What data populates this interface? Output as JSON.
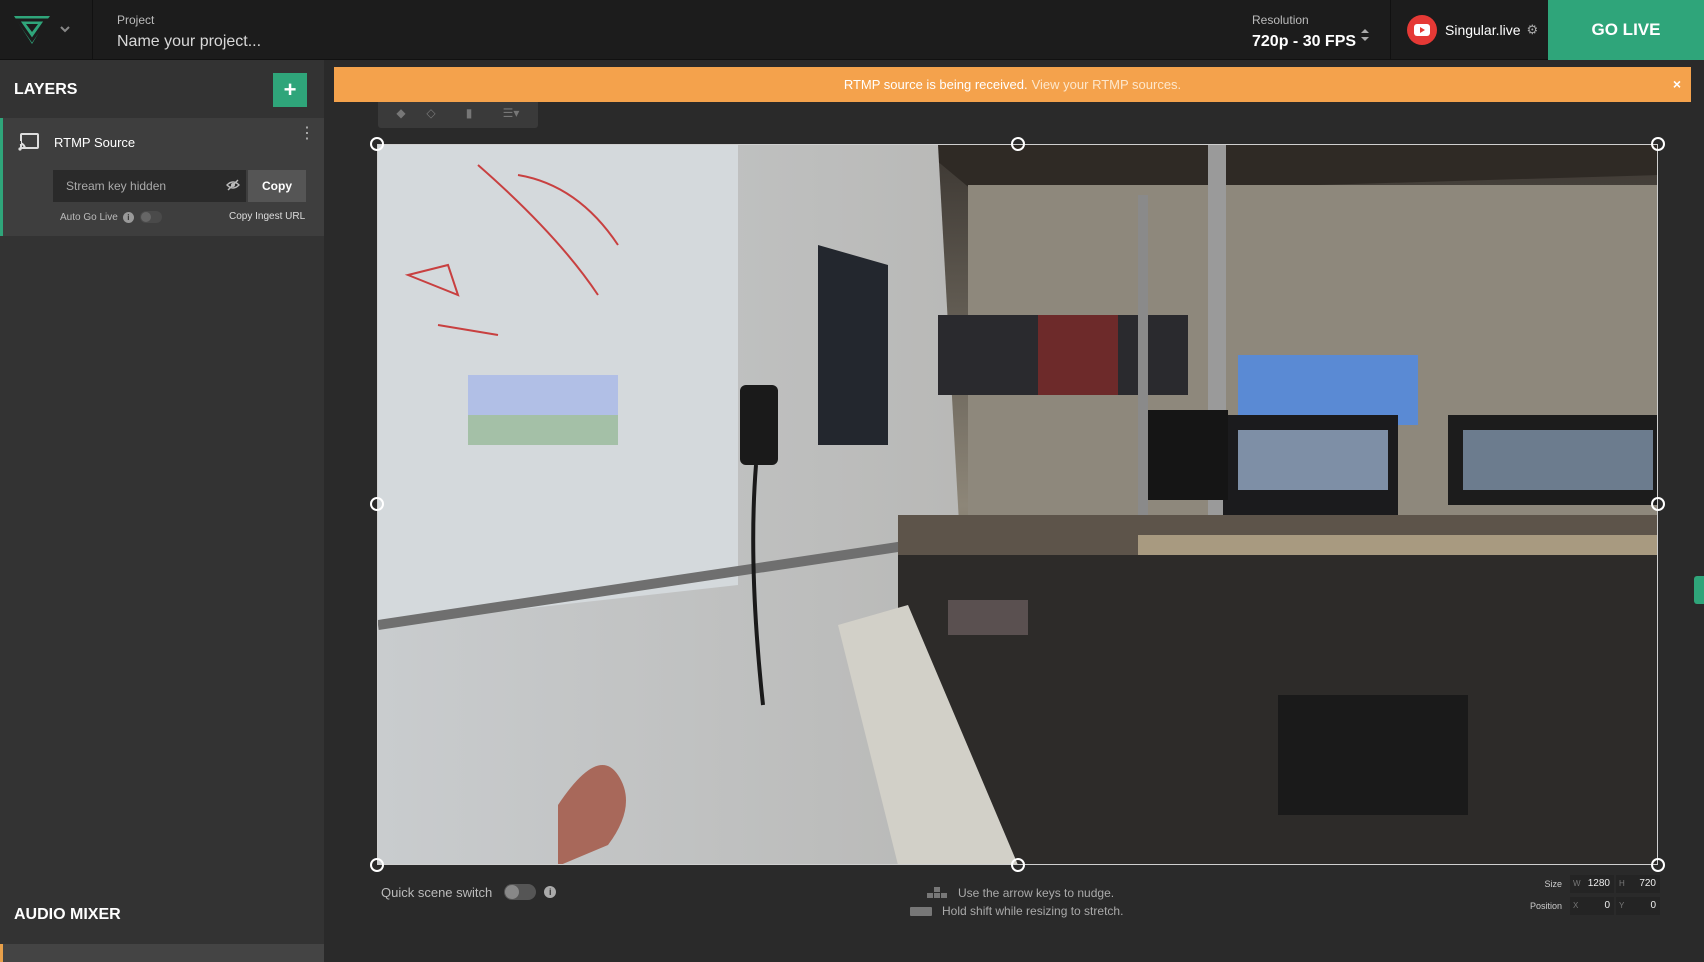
{
  "app": {
    "logo_icon": "singular-logo-icon",
    "accent_color": "#2fa57a",
    "warning_color": "#f4a24c"
  },
  "header": {
    "project_label": "Project",
    "project_placeholder": "Name your project...",
    "resolution_label": "Resolution",
    "resolution_value": "720p - 30 FPS",
    "account_name": "Singular.live",
    "account_icon": "youtube-icon",
    "go_live_label": "GO LIVE"
  },
  "sidebar": {
    "layers_title": "LAYERS",
    "add_label": "+",
    "layer": {
      "name": "RTMP Source",
      "icon": "cast-icon",
      "stream_key_text": "Stream key hidden",
      "copy_label": "Copy",
      "auto_go_live_label": "Auto Go Live",
      "copy_ingest_label": "Copy Ingest URL"
    },
    "audio_mixer_title": "AUDIO MIXER"
  },
  "banner": {
    "message": "RTMP source is being received.",
    "link_text": "View your RTMP sources.",
    "close_label": "×"
  },
  "canvas": {
    "quick_scene_switch_label": "Quick scene switch",
    "hint_nudge": "Use the arrow keys to nudge.",
    "hint_stretch": "Hold shift while resizing to stretch.",
    "size_label": "Size",
    "position_label": "Position",
    "width_label": "W",
    "height_label": "H",
    "x_label": "X",
    "y_label": "Y",
    "width_value": "1280",
    "height_value": "720",
    "x_value": "0",
    "y_value": "0"
  }
}
